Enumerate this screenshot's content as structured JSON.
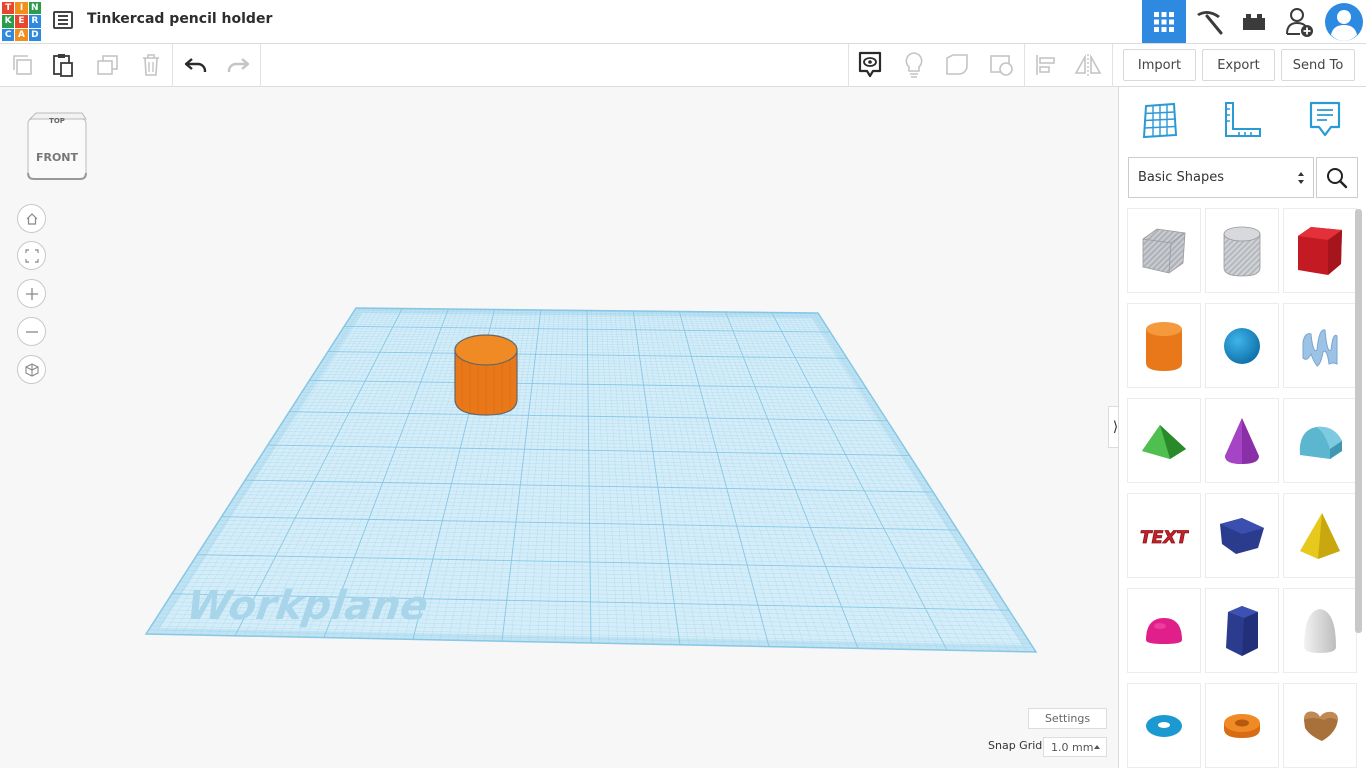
{
  "header": {
    "logo_letters": [
      "T",
      "I",
      "N",
      "K",
      "E",
      "R",
      "C",
      "A",
      "D"
    ],
    "logo_colors": [
      "#e8472e",
      "#f18e1c",
      "#2b9c4c",
      "#2b9c4c",
      "#e8472e",
      "#2d8ae0",
      "#2d8ae0",
      "#f18e1c",
      "#2d8ae0"
    ],
    "design_title": "Tinkercad pencil holder",
    "icons": [
      "3d-design-icon",
      "pickaxe-icon",
      "bricks-icon",
      "add-user-icon",
      "avatar-icon"
    ]
  },
  "toolbar": {
    "actions": [
      "copy",
      "paste",
      "duplicate",
      "delete",
      "undo",
      "redo"
    ],
    "view_tools": [
      "notes-toggle",
      "hint-bulb",
      "solid-shape",
      "hole-shape",
      "align",
      "mirror"
    ],
    "import_label": "Import",
    "export_label": "Export",
    "send_to_label": "Send To"
  },
  "canvas": {
    "viewcube": {
      "top_label": "TOP",
      "front_label": "FRONT"
    },
    "nav_buttons": [
      "home-view",
      "fit-all",
      "zoom-in",
      "zoom-out",
      "perspective"
    ],
    "workplane_label": "Workplane",
    "objects": [
      {
        "type": "cylinder",
        "color": "#f08a24"
      }
    ],
    "settings_label": "Settings",
    "snap_grid_label": "Snap Grid",
    "snap_grid_value": "1.0 mm"
  },
  "panel": {
    "tabs": [
      "workplane-grid",
      "ruler",
      "notes"
    ],
    "library_select": "Basic Shapes",
    "shapes": [
      {
        "name": "box-hole",
        "color": "#b9bcc2"
      },
      {
        "name": "cylinder-hole",
        "color": "#c3c6cb"
      },
      {
        "name": "box",
        "color": "#d1202a"
      },
      {
        "name": "cylinder",
        "color": "#f08a24"
      },
      {
        "name": "sphere",
        "color": "#1a8fd0"
      },
      {
        "name": "scribble",
        "color": "#9cc2e6"
      },
      {
        "name": "roof",
        "color": "#3aa43a"
      },
      {
        "name": "cone",
        "color": "#8a2fa8"
      },
      {
        "name": "round-roof",
        "color": "#5cb6cf"
      },
      {
        "name": "text",
        "color": "#c3222b"
      },
      {
        "name": "polygon",
        "color": "#2b3b8e"
      },
      {
        "name": "pyramid",
        "color": "#e7c81d"
      },
      {
        "name": "half-sphere",
        "color": "#e01f8a"
      },
      {
        "name": "polygon-prism",
        "color": "#2b3b8e"
      },
      {
        "name": "paraboloid",
        "color": "#dedede"
      },
      {
        "name": "torus",
        "color": "#1b9ad2"
      },
      {
        "name": "tube",
        "color": "#f08a24"
      },
      {
        "name": "heart",
        "color": "#a8703a"
      }
    ],
    "text_shape_label": "TEXT"
  }
}
